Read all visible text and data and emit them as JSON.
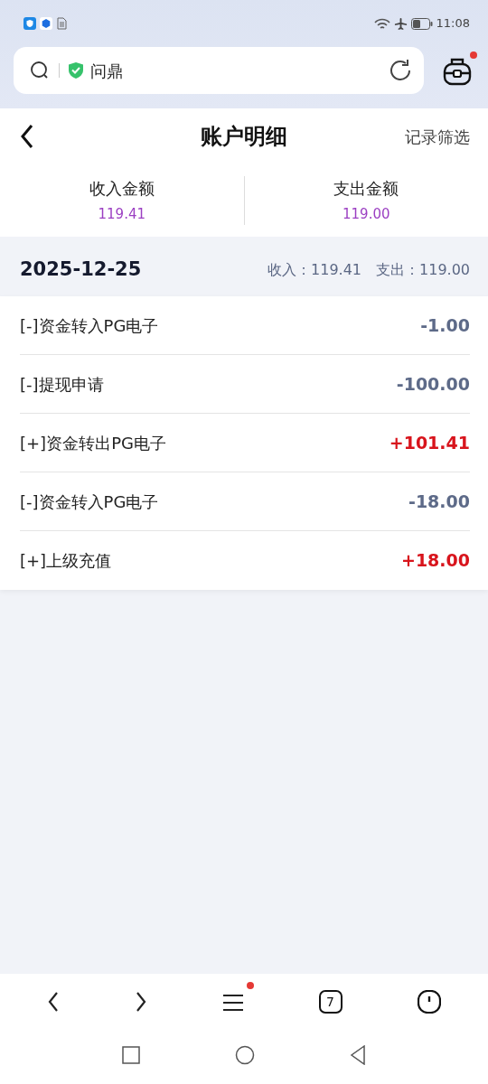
{
  "status_bar": {
    "time": "11:08"
  },
  "address_bar": {
    "text": "问鼎",
    "toolbox_notification": true
  },
  "header": {
    "title": "账户明细",
    "filter": "记录筛选"
  },
  "summary": [
    {
      "label": "收入金额",
      "value": "119.41"
    },
    {
      "label": "支出金额",
      "value": "119.00"
    }
  ],
  "day": {
    "date": "2025-12-25",
    "income_label": "收入：",
    "income": "119.41",
    "expense_label": "支出：",
    "expense": "119.00"
  },
  "records": [
    {
      "kind": "out",
      "title": "[-]资金转入PG电子",
      "amount": "-1.00"
    },
    {
      "kind": "out",
      "title": "[-]提现申请",
      "amount": "-100.00"
    },
    {
      "kind": "in",
      "title": "[+]资金转出PG电子",
      "amount": "+101.41"
    },
    {
      "kind": "out",
      "title": "[-]资金转入PG电子",
      "amount": "-18.00"
    },
    {
      "kind": "in",
      "title": "[+]上级充值",
      "amount": "+18.00"
    }
  ],
  "bottom_nav": {
    "tab_count": "7",
    "menu_notification": true
  }
}
